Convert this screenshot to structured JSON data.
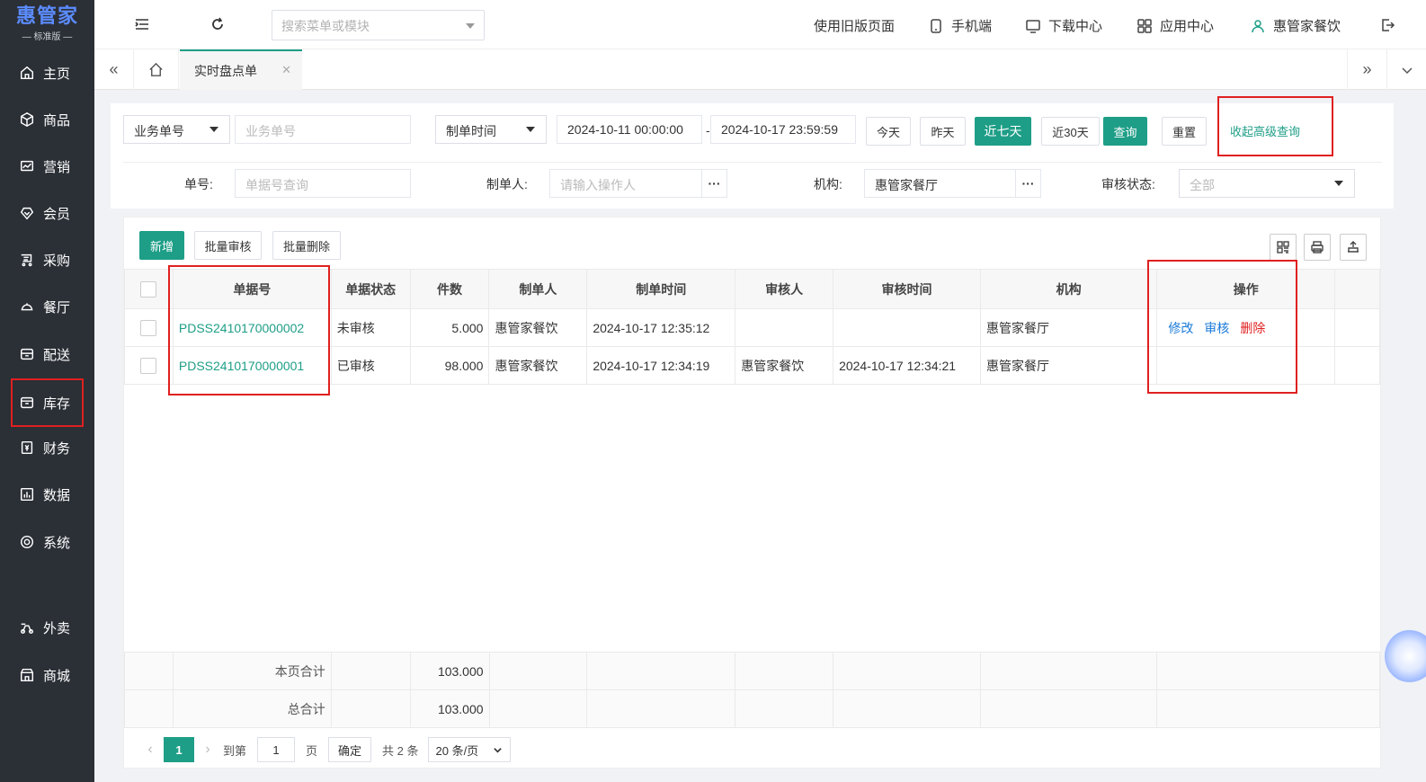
{
  "brand": {
    "name": "惠管家",
    "edition": "标准版"
  },
  "sidebar": {
    "items": [
      {
        "label": "主页",
        "icon": "home-icon"
      },
      {
        "label": "商品",
        "icon": "box-icon"
      },
      {
        "label": "营销",
        "icon": "chart-icon"
      },
      {
        "label": "会员",
        "icon": "vip-icon"
      },
      {
        "label": "采购",
        "icon": "purchase-icon"
      },
      {
        "label": "餐厅",
        "icon": "dish-icon"
      },
      {
        "label": "配送",
        "icon": "delivery-icon"
      },
      {
        "label": "库存",
        "icon": "inventory-icon"
      },
      {
        "label": "财务",
        "icon": "finance-icon"
      },
      {
        "label": "数据",
        "icon": "data-icon"
      },
      {
        "label": "系统",
        "icon": "settings-icon"
      },
      {
        "label": "外卖",
        "icon": "takeout-icon"
      },
      {
        "label": "商城",
        "icon": "store-icon"
      }
    ]
  },
  "header": {
    "search_placeholder": "搜索菜单或模块",
    "links": {
      "old_version": "使用旧版页面",
      "mobile": "手机端",
      "download": "下载中心",
      "apps": "应用中心",
      "user": "惠管家餐饮"
    }
  },
  "tabs": {
    "active": "实时盘点单"
  },
  "filter": {
    "biz_field": "业务单号",
    "biz_placeholder": "业务单号",
    "time_field": "制单时间",
    "date_from": "2024-10-11 00:00:00",
    "date_sep": "-",
    "date_to": "2024-10-17 23:59:59",
    "btn_today": "今天",
    "btn_yesterday": "昨天",
    "btn_7days": "近七天",
    "btn_30days": "近30天",
    "btn_query": "查询",
    "btn_reset": "重置",
    "btn_collapse": "收起高级查询",
    "no_label": "单号:",
    "no_placeholder": "单据号查询",
    "maker_label": "制单人:",
    "maker_placeholder": "请输入操作人",
    "org_label": "机构:",
    "org_value": "惠管家餐厅",
    "status_label": "审核状态:",
    "status_value": "全部"
  },
  "toolbar": {
    "add": "新增",
    "batch_audit": "批量审核",
    "batch_delete": "批量删除"
  },
  "table": {
    "columns": [
      "单据号",
      "单据状态",
      "件数",
      "制单人",
      "制单时间",
      "审核人",
      "审核时间",
      "机构",
      "操作"
    ],
    "rows": [
      {
        "no": "PDSS2410170000002",
        "status": "未审核",
        "qty": "5.000",
        "maker": "惠管家餐饮",
        "made_at": "2024-10-17 12:35:12",
        "auditor": "",
        "audited_at": "",
        "org": "惠管家餐厅",
        "ops": [
          "修改",
          "审核",
          "删除"
        ]
      },
      {
        "no": "PDSS2410170000001",
        "status": "已审核",
        "qty": "98.000",
        "maker": "惠管家餐饮",
        "made_at": "2024-10-17 12:34:19",
        "auditor": "惠管家餐饮",
        "audited_at": "2024-10-17 12:34:21",
        "org": "惠管家餐厅",
        "ops": []
      }
    ],
    "page_total_label": "本页合计",
    "page_total": "103.000",
    "grand_total_label": "总合计",
    "grand_total": "103.000"
  },
  "pager": {
    "current": "1",
    "goto_label": "到第",
    "goto_value": "1",
    "page_unit": "页",
    "confirm": "确定",
    "total": "共 2 条",
    "page_size": "20 条/页"
  },
  "colors": {
    "accent": "#1e9e87",
    "sidebar": "#2b2f36",
    "highlight": "#e02020",
    "link_blue": "#1a7ad8"
  }
}
